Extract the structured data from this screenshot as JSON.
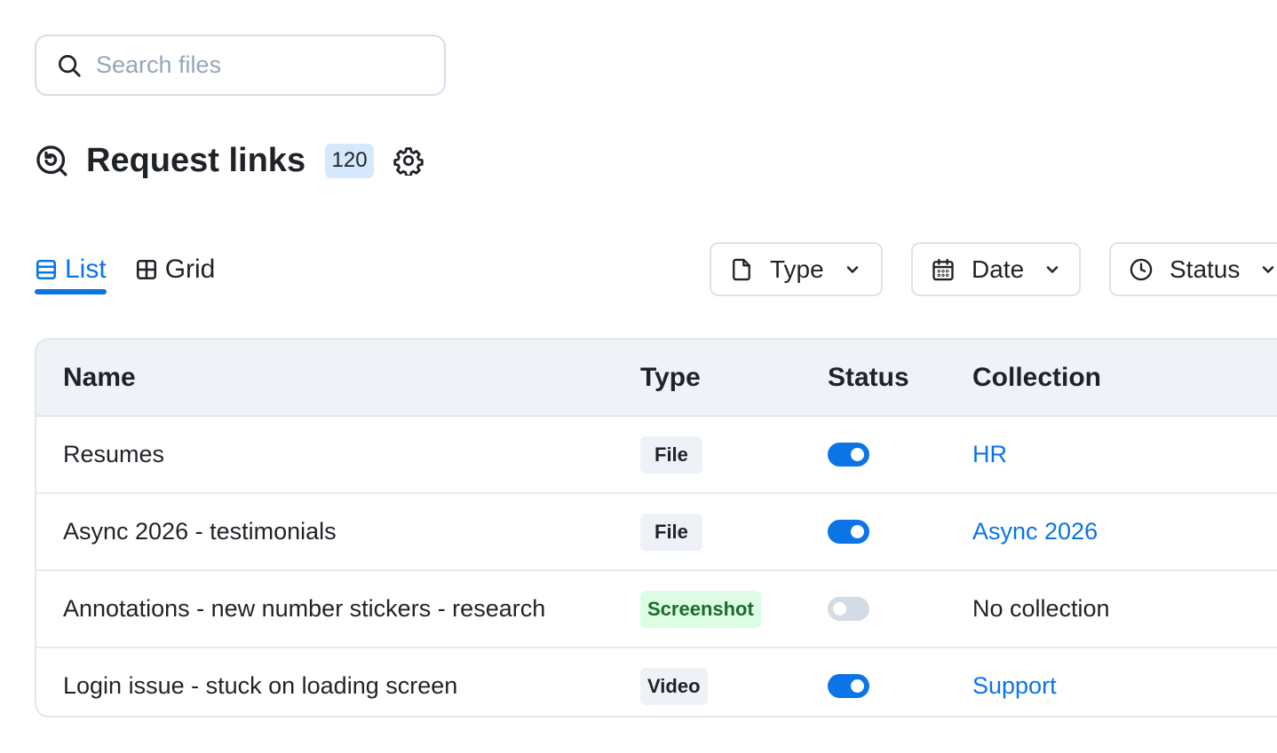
{
  "search": {
    "placeholder": "Search files",
    "value": ""
  },
  "header": {
    "title": "Request links",
    "count": "120"
  },
  "view_tabs": [
    {
      "label": "List",
      "active": true,
      "icon": "list-icon"
    },
    {
      "label": "Grid",
      "active": false,
      "icon": "grid-icon"
    }
  ],
  "filters": [
    {
      "label": "Type",
      "icon": "file-icon"
    },
    {
      "label": "Date",
      "icon": "calendar-icon"
    },
    {
      "label": "Status",
      "icon": "clock-icon"
    }
  ],
  "table": {
    "columns": [
      "Name",
      "Type",
      "Status",
      "Collection"
    ],
    "rows": [
      {
        "name": "Resumes",
        "type": "File",
        "enabled": true,
        "collection": "HR"
      },
      {
        "name": "Async 2026 - testimonials",
        "type": "File",
        "enabled": true,
        "collection": "Async 2026"
      },
      {
        "name": "Annotations - new number stickers - research",
        "type": "Screenshot",
        "enabled": false,
        "collection": "No collection"
      },
      {
        "name": "Login issue - stuck on loading screen",
        "type": "Video",
        "enabled": true,
        "collection": "Support"
      }
    ]
  },
  "colors": {
    "accent": "#0b74e6",
    "badge_bg": "#d6e9fc",
    "header_bg": "#eff3f8",
    "screenshot_badge_bg": "#dcfce4",
    "screenshot_badge_text": "#1b6b2b"
  }
}
